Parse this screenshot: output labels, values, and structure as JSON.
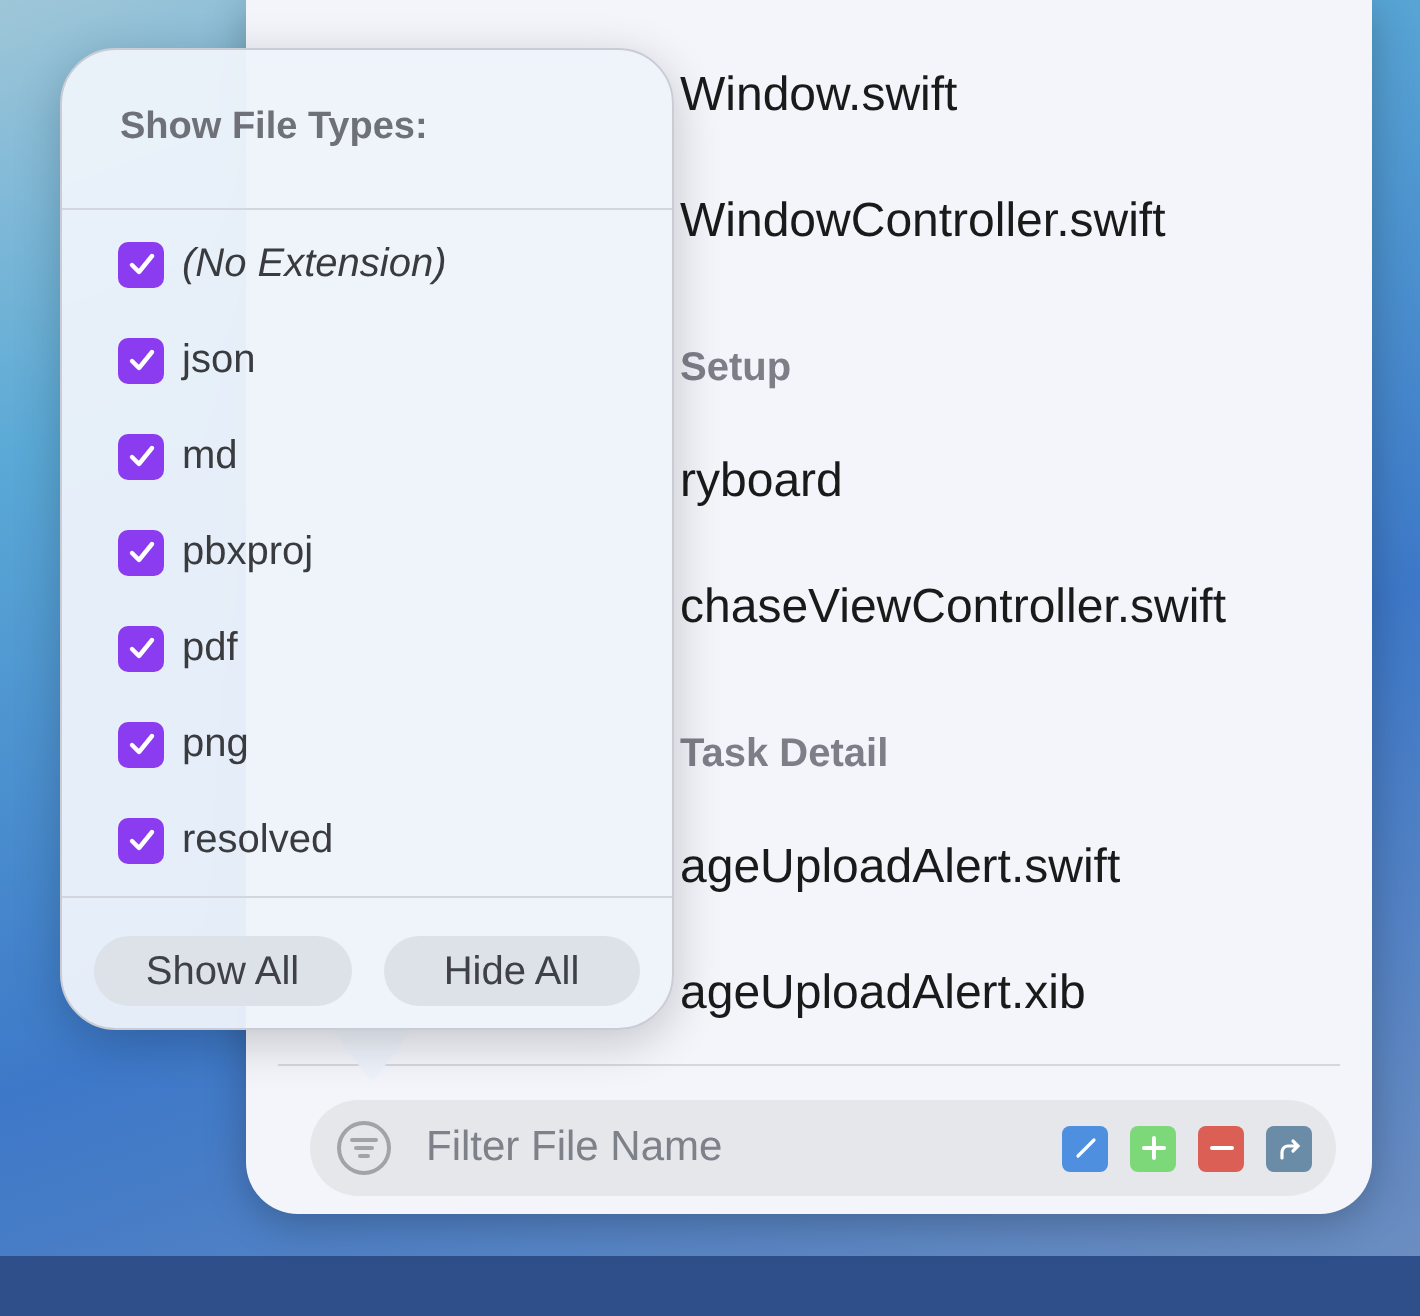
{
  "file_list": {
    "items": [
      {
        "kind": "file",
        "name": "Window.swift"
      },
      {
        "kind": "file",
        "name": "WindowController.swift"
      },
      {
        "kind": "section",
        "name": "Setup"
      },
      {
        "kind": "file",
        "name": "ryboard"
      },
      {
        "kind": "file",
        "name": "chaseViewController.swift"
      },
      {
        "kind": "section",
        "name": "Task Detail"
      },
      {
        "kind": "file",
        "name": "ageUploadAlert.swift"
      },
      {
        "kind": "file",
        "name": "ageUploadAlert.xib"
      }
    ]
  },
  "filter_bar": {
    "placeholder": "Filter File Name"
  },
  "popover": {
    "title": "Show File Types:",
    "items": [
      {
        "label": "(No Extension)",
        "checked": true,
        "italic": true
      },
      {
        "label": "json",
        "checked": true,
        "italic": false
      },
      {
        "label": "md",
        "checked": true,
        "italic": false
      },
      {
        "label": "pbxproj",
        "checked": true,
        "italic": false
      },
      {
        "label": "pdf",
        "checked": true,
        "italic": false
      },
      {
        "label": "png",
        "checked": true,
        "italic": false
      },
      {
        "label": "resolved",
        "checked": true,
        "italic": false
      }
    ],
    "buttons": [
      "Show All",
      "Hide All"
    ]
  }
}
